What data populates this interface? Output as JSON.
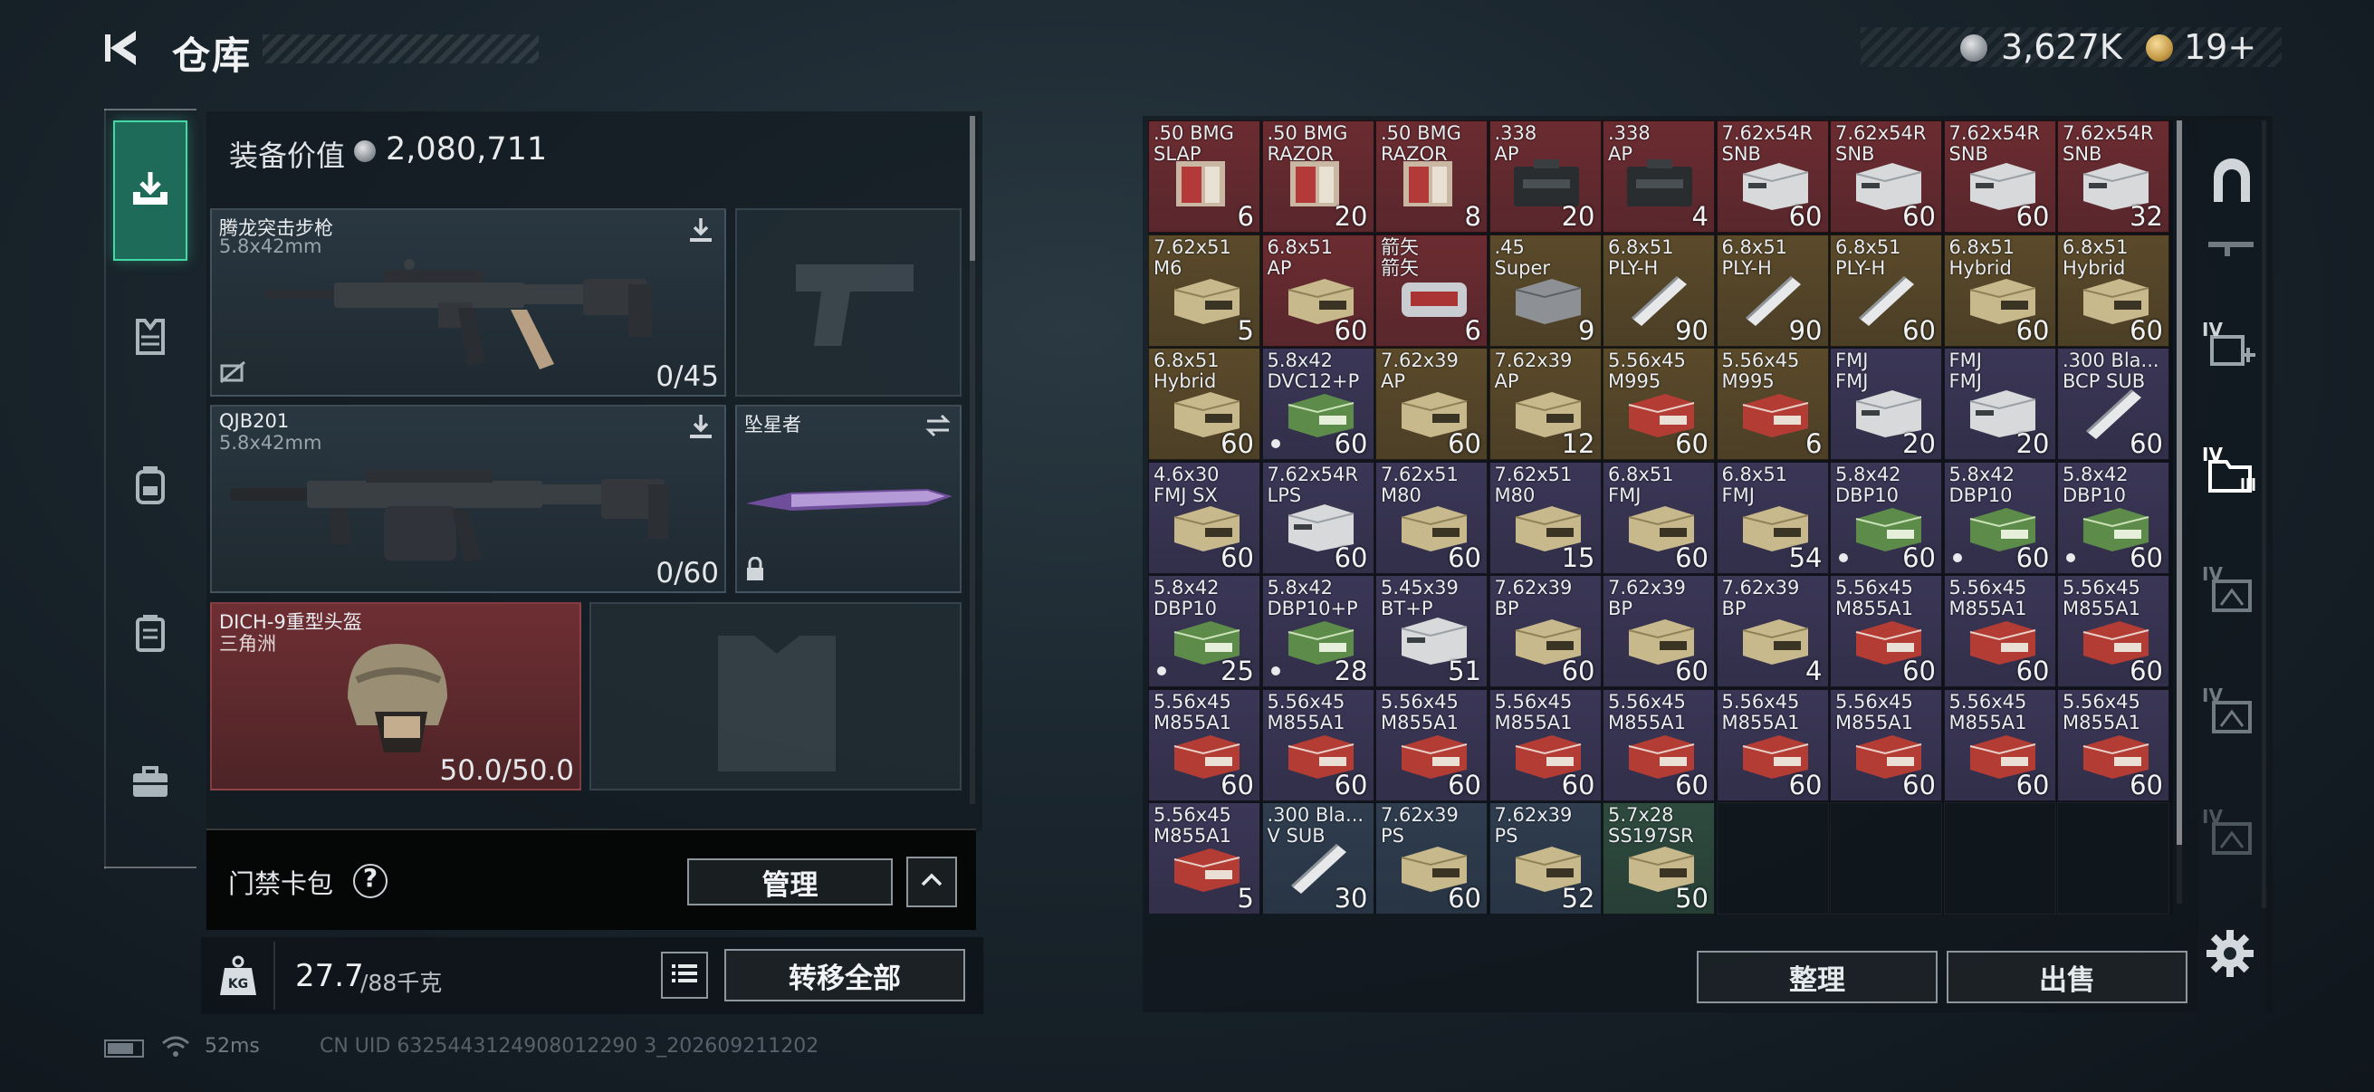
{
  "header": {
    "title": "仓库",
    "currency1": "3,627K",
    "currency2": "19+"
  },
  "equipment": {
    "value_label": "装备价值",
    "value": "2,080,711",
    "primary_weapon": {
      "name": "腾龙突击步枪",
      "caliber": "5.8x42mm",
      "ammo": "0/45"
    },
    "secondary_weapon": {
      "name": "QJB201",
      "caliber": "5.8x42mm",
      "ammo": "0/60"
    },
    "melee": {
      "name": "坠星者"
    },
    "helmet": {
      "name": "DICH-9重型头盔",
      "sub": "三角洲",
      "durability": "50.0/50.0"
    }
  },
  "access_card": {
    "label": "门禁卡包",
    "help": "?",
    "manage_label": "管理"
  },
  "weight": {
    "value": "27.7",
    "capacity": "/88千克",
    "transfer_label": "转移全部"
  },
  "status": {
    "ping": "52ms",
    "uid": "CN UID 6325443124908012290 3_202609211202"
  },
  "grid_actions": {
    "sort_label": "整理",
    "sell_label": "出售"
  },
  "inventory": [
    {
      "label": ".50 BMG\nSLAP",
      "qty": "6",
      "bg": "red",
      "box": "red"
    },
    {
      "label": ".50 BMG\nRAZOR",
      "qty": "20",
      "bg": "red",
      "box": "red"
    },
    {
      "label": ".50 BMG\nRAZOR",
      "qty": "8",
      "bg": "red",
      "box": "red"
    },
    {
      "label": ".338\nAP",
      "qty": "20",
      "bg": "red",
      "box": "dark"
    },
    {
      "label": ".338\nAP",
      "qty": "4",
      "bg": "red",
      "box": "dark"
    },
    {
      "label": "7.62x54R\nSNB",
      "qty": "60",
      "bg": "red",
      "box": "white"
    },
    {
      "label": "7.62x54R\nSNB",
      "qty": "60",
      "bg": "red",
      "box": "white"
    },
    {
      "label": "7.62x54R\nSNB",
      "qty": "60",
      "bg": "red",
      "box": "white"
    },
    {
      "label": "7.62x54R\nSNB",
      "qty": "32",
      "bg": "red",
      "box": "white"
    },
    {
      "label": "7.62x51\nM6",
      "qty": "5",
      "bg": "gold",
      "box": "tan"
    },
    {
      "label": "6.8x51\nAP",
      "qty": "60",
      "bg": "red",
      "box": "tan"
    },
    {
      "label": "箭矢\n箭矢",
      "qty": "6",
      "bg": "red",
      "box": "tin"
    },
    {
      "label": ".45\nSuper",
      "qty": "9",
      "bg": "gold",
      "box": "grey"
    },
    {
      "label": "6.8x51\nPLY-H",
      "qty": "90",
      "bg": "gold",
      "box": "tube"
    },
    {
      "label": "6.8x51\nPLY-H",
      "qty": "90",
      "bg": "gold",
      "box": "tube"
    },
    {
      "label": "6.8x51\nPLY-H",
      "qty": "60",
      "bg": "gold",
      "box": "tube"
    },
    {
      "label": "6.8x51\nHybrid",
      "qty": "60",
      "bg": "gold",
      "box": "tan"
    },
    {
      "label": "6.8x51\nHybrid",
      "qty": "60",
      "bg": "gold",
      "box": "tan"
    },
    {
      "label": "6.8x51\nHybrid",
      "qty": "60",
      "bg": "gold",
      "box": "tan"
    },
    {
      "label": "5.8x42\nDVC12+P",
      "qty": "60",
      "bg": "purple",
      "box": "green",
      "dot": true
    },
    {
      "label": "7.62x39\nAP",
      "qty": "60",
      "bg": "gold",
      "box": "tan"
    },
    {
      "label": "7.62x39\nAP",
      "qty": "12",
      "bg": "gold",
      "box": "tan"
    },
    {
      "label": "5.56x45\nM995",
      "qty": "60",
      "bg": "gold",
      "box": "redbox"
    },
    {
      "label": "5.56x45\nM995",
      "qty": "6",
      "bg": "gold",
      "box": "redbox"
    },
    {
      "label": "FMJ\nFMJ",
      "qty": "20",
      "bg": "purple",
      "box": "white"
    },
    {
      "label": "FMJ\nFMJ",
      "qty": "20",
      "bg": "purple",
      "box": "white"
    },
    {
      "label": ".300 Bla...\nBCP SUB",
      "qty": "60",
      "bg": "purple",
      "box": "tube"
    },
    {
      "label": "4.6x30\nFMJ SX",
      "qty": "60",
      "bg": "purple",
      "box": "tan"
    },
    {
      "label": "7.62x54R\nLPS",
      "qty": "60",
      "bg": "purple",
      "box": "white"
    },
    {
      "label": "7.62x51\nM80",
      "qty": "60",
      "bg": "purple",
      "box": "tan"
    },
    {
      "label": "7.62x51\nM80",
      "qty": "15",
      "bg": "purple",
      "box": "tan"
    },
    {
      "label": "6.8x51\nFMJ",
      "qty": "60",
      "bg": "purple",
      "box": "tan"
    },
    {
      "label": "6.8x51\nFMJ",
      "qty": "54",
      "bg": "purple",
      "box": "tan"
    },
    {
      "label": "5.8x42\nDBP10",
      "qty": "60",
      "bg": "purple",
      "box": "green",
      "dot": true
    },
    {
      "label": "5.8x42\nDBP10",
      "qty": "60",
      "bg": "purple",
      "box": "green",
      "dot": true
    },
    {
      "label": "5.8x42\nDBP10",
      "qty": "60",
      "bg": "purple",
      "box": "green",
      "dot": true
    },
    {
      "label": "5.8x42\nDBP10",
      "qty": "25",
      "bg": "purple",
      "box": "green",
      "dot": true
    },
    {
      "label": "5.8x42\nDBP10+P",
      "qty": "28",
      "bg": "purple",
      "box": "green",
      "dot": true
    },
    {
      "label": "5.45x39\nBT+P",
      "qty": "51",
      "bg": "purple",
      "box": "white"
    },
    {
      "label": "7.62x39\nBP",
      "qty": "60",
      "bg": "purple",
      "box": "tan"
    },
    {
      "label": "7.62x39\nBP",
      "qty": "60",
      "bg": "purple",
      "box": "tan"
    },
    {
      "label": "7.62x39\nBP",
      "qty": "4",
      "bg": "purple",
      "box": "tan"
    },
    {
      "label": "5.56x45\nM855A1",
      "qty": "60",
      "bg": "purple",
      "box": "redbox"
    },
    {
      "label": "5.56x45\nM855A1",
      "qty": "60",
      "bg": "purple",
      "box": "redbox"
    },
    {
      "label": "5.56x45\nM855A1",
      "qty": "60",
      "bg": "purple",
      "box": "redbox"
    },
    {
      "label": "5.56x45\nM855A1",
      "qty": "60",
      "bg": "purple",
      "box": "redbox"
    },
    {
      "label": "5.56x45\nM855A1",
      "qty": "60",
      "bg": "purple",
      "box": "redbox"
    },
    {
      "label": "5.56x45\nM855A1",
      "qty": "60",
      "bg": "purple",
      "box": "redbox"
    },
    {
      "label": "5.56x45\nM855A1",
      "qty": "60",
      "bg": "purple",
      "box": "redbox"
    },
    {
      "label": "5.56x45\nM855A1",
      "qty": "60",
      "bg": "purple",
      "box": "redbox"
    },
    {
      "label": "5.56x45\nM855A1",
      "qty": "60",
      "bg": "purple",
      "box": "redbox"
    },
    {
      "label": "5.56x45\nM855A1",
      "qty": "60",
      "bg": "purple",
      "box": "redbox"
    },
    {
      "label": "5.56x45\nM855A1",
      "qty": "60",
      "bg": "purple",
      "box": "redbox"
    },
    {
      "label": "5.56x45\nM855A1",
      "qty": "60",
      "bg": "purple",
      "box": "redbox"
    },
    {
      "label": "5.56x45\nM855A1",
      "qty": "5",
      "bg": "purple",
      "box": "redbox"
    },
    {
      "label": ".300 Bla...\nV SUB",
      "qty": "30",
      "bg": "blue",
      "box": "tube"
    },
    {
      "label": "7.62x39\nPS",
      "qty": "60",
      "bg": "blue",
      "box": "tan"
    },
    {
      "label": "7.62x39\nPS",
      "qty": "52",
      "bg": "blue",
      "box": "tan"
    },
    {
      "label": "5.7x28\nSS197SR",
      "qty": "50",
      "bg": "green",
      "box": "tan"
    }
  ],
  "colors": {
    "cell_red": "#6b2c31",
    "cell_gold": "#5b4a2a",
    "cell_purple": "#3b3656",
    "cell_blue": "#2f3d4f",
    "cell_green": "#2e4a3e",
    "accent_green": "#42d9a5"
  },
  "icons": {
    "back": "back-arrow-icon",
    "sidebar": [
      "download-icon",
      "vest-icon",
      "backpack-icon",
      "chest-rig-icon",
      "toolbox-icon"
    ],
    "rail": [
      "safe-icon",
      "rifle-icon",
      "case-plus-icon",
      "folder-icon",
      "case-icon",
      "case-icon",
      "case-icon"
    ]
  }
}
